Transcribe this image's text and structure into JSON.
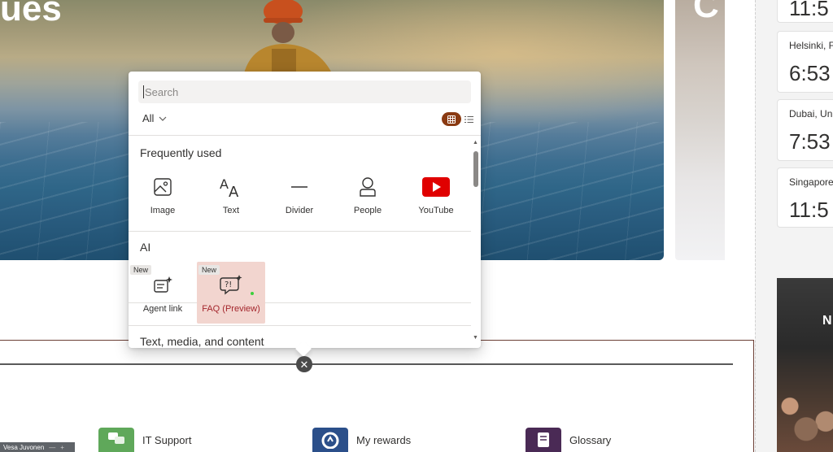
{
  "hero": {
    "title_fragment": "ues",
    "side_fragment": "C"
  },
  "toolbox": {
    "search_placeholder": "Search",
    "filter_label": "All",
    "view_modes": [
      "grid-view-icon",
      "list-view-icon"
    ],
    "accent_color": "#8a3a12",
    "sections": [
      {
        "title": "Frequently used",
        "items": [
          {
            "label": "Image",
            "icon": "image-icon"
          },
          {
            "label": "Text",
            "icon": "text-icon"
          },
          {
            "label": "Divider",
            "icon": "divider-icon"
          },
          {
            "label": "People",
            "icon": "people-icon"
          },
          {
            "label": "YouTube",
            "icon": "youtube-icon"
          }
        ]
      },
      {
        "title": "AI",
        "items": [
          {
            "label": "Agent link",
            "icon": "agent-link-icon",
            "badge": "New"
          },
          {
            "label": "FAQ (Preview)",
            "icon": "faq-icon",
            "badge": "New",
            "selected": true
          }
        ]
      },
      {
        "title": "Text, media, and content"
      }
    ]
  },
  "clocks": [
    {
      "city": "",
      "time": "11:5"
    },
    {
      "city": "Helsinki, F",
      "time": "6:53"
    },
    {
      "city": "Dubai, Un",
      "time": "7:53"
    },
    {
      "city": "Singapore",
      "time": "11:5"
    }
  ],
  "news_tile_fragment": "N",
  "quick_links": [
    {
      "label": "IT Support",
      "color": "#5fa85a"
    },
    {
      "label": "My rewards",
      "color": "#2b4f8a"
    },
    {
      "label": "Glossary",
      "color": "#4a2a55"
    }
  ],
  "user_chip": "Vesa Juvonen"
}
